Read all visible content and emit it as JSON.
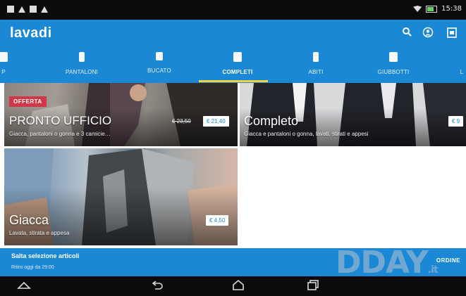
{
  "status_bar": {
    "time": "15:38",
    "icons": [
      "notification-icon",
      "warning-icon",
      "image-icon",
      "alert-icon",
      "wifi-icon",
      "battery-icon"
    ]
  },
  "app_bar": {
    "logo": "lavadi",
    "icons": [
      "search-icon",
      "account-icon",
      "cart-icon"
    ],
    "color": "#1b88d6"
  },
  "tabs": [
    {
      "label": "P",
      "icon": "shirt-icon"
    },
    {
      "label": "PANTALONI",
      "icon": "pants-icon"
    },
    {
      "label": "BUCATO",
      "icon": "laundry-icon"
    },
    {
      "label": "COMPLETI",
      "icon": "suit-icon",
      "active": true
    },
    {
      "label": "ABITI",
      "icon": "dress-icon"
    },
    {
      "label": "GIUBBOTTI",
      "icon": "jacket-icon"
    },
    {
      "label": "L",
      "icon": "other-icon"
    }
  ],
  "cards": [
    {
      "badge": "OFFERTA",
      "title": "PRONTO UFFICIO",
      "subtitle": "Giacca, pantaloni o gonna e 3 camicie…",
      "old_price": "€ 23,50",
      "price": "€ 21,40"
    },
    {
      "title": "Completo",
      "subtitle": "Giacca e pantaloni o gonna, lavati, stirati e appesi",
      "price": "€ 9"
    },
    {
      "title": "Giacca",
      "subtitle": "Lavata, stirata e appesa",
      "price": "€ 4,50"
    }
  ],
  "bottom_bar": {
    "title": "Salta selezione articoli",
    "subtitle": "Ritiro oggi da 29:00",
    "action": "ORDINE"
  },
  "watermark": {
    "text": "DDAY",
    "suffix": ".it"
  },
  "nav_bar": {
    "icons": [
      "collapse-icon",
      "back-icon",
      "home-icon",
      "recents-icon"
    ]
  }
}
